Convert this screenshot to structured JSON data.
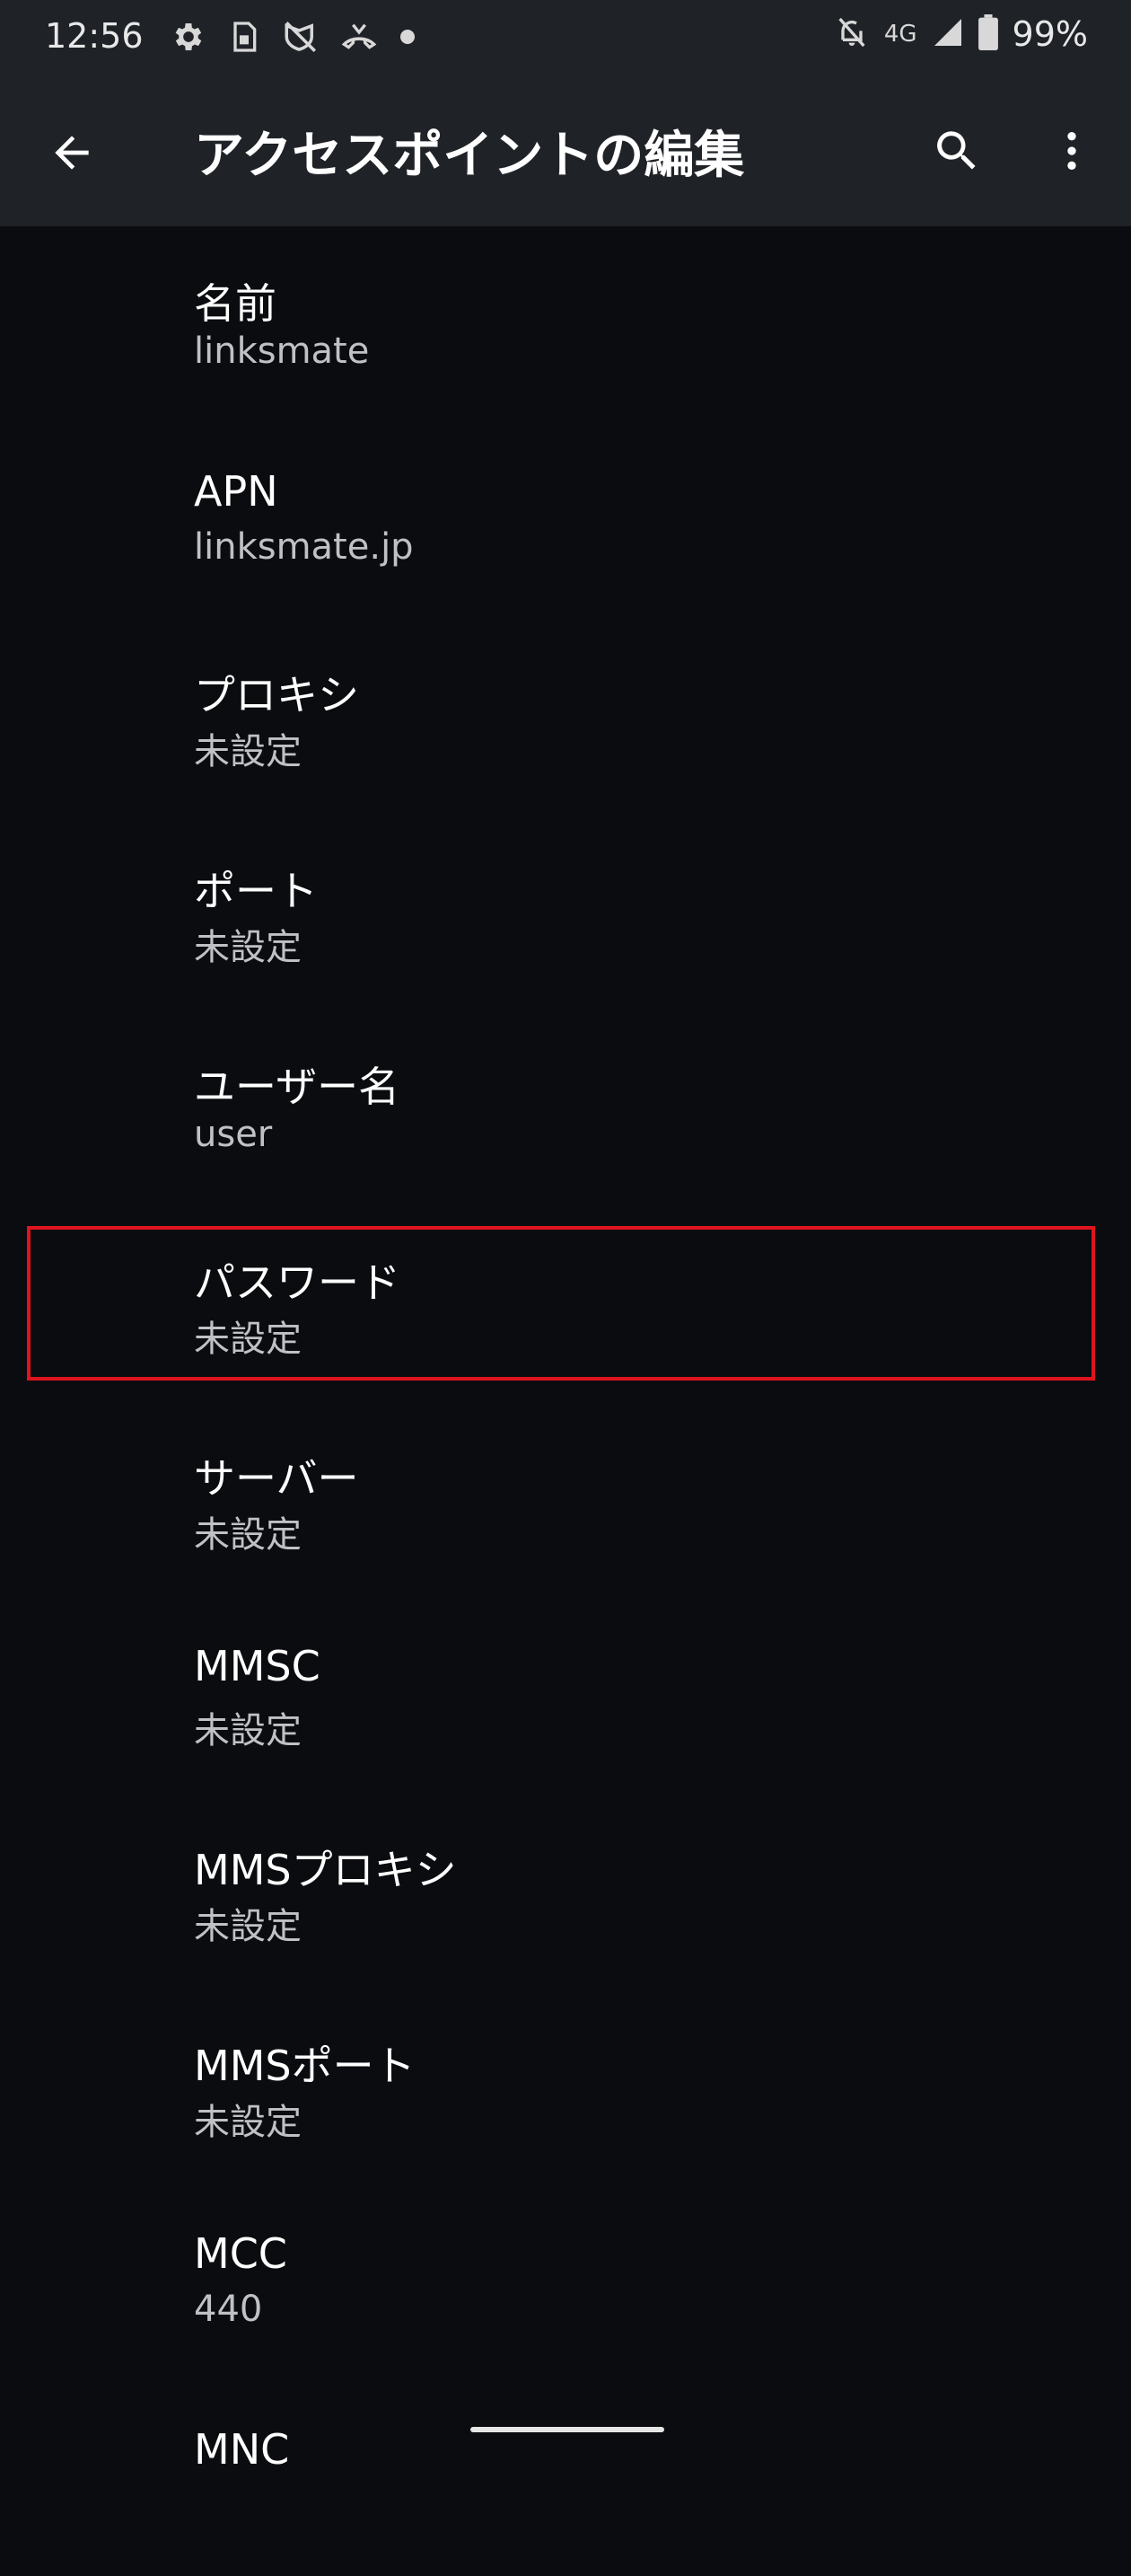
{
  "status_bar": {
    "time": "12:56",
    "network": "4G",
    "battery": "99%",
    "icons": [
      "gear-icon",
      "sim-icon",
      "no-vpn-icon",
      "call-forward-icon",
      "dot-icon",
      "bell-off-icon",
      "signal-icon",
      "battery-icon"
    ]
  },
  "app_bar": {
    "title": "アクセスポイントの編集",
    "icons": [
      "back-arrow-icon",
      "search-icon",
      "more-vert-icon"
    ]
  },
  "settings": [
    {
      "title": "名前",
      "value": "linksmate"
    },
    {
      "title": "APN",
      "value": "linksmate.jp"
    },
    {
      "title": "プロキシ",
      "value": "未設定"
    },
    {
      "title": "ポート",
      "value": "未設定"
    },
    {
      "title": "ユーザー名",
      "value": "user"
    },
    {
      "title": "パスワード",
      "value": "未設定"
    },
    {
      "title": "サーバー",
      "value": "未設定"
    },
    {
      "title": "MMSC",
      "value": "未設定"
    },
    {
      "title": "MMSプロキシ",
      "value": "未設定"
    },
    {
      "title": "MMSポート",
      "value": "未設定"
    },
    {
      "title": "MCC",
      "value": "440"
    },
    {
      "title": "MNC",
      "value": ""
    }
  ],
  "colors": {
    "background": "#0b0c10",
    "bar": "#1f2227",
    "highlight": "#e0141e",
    "secondary_text": "#bfc1c5"
  }
}
